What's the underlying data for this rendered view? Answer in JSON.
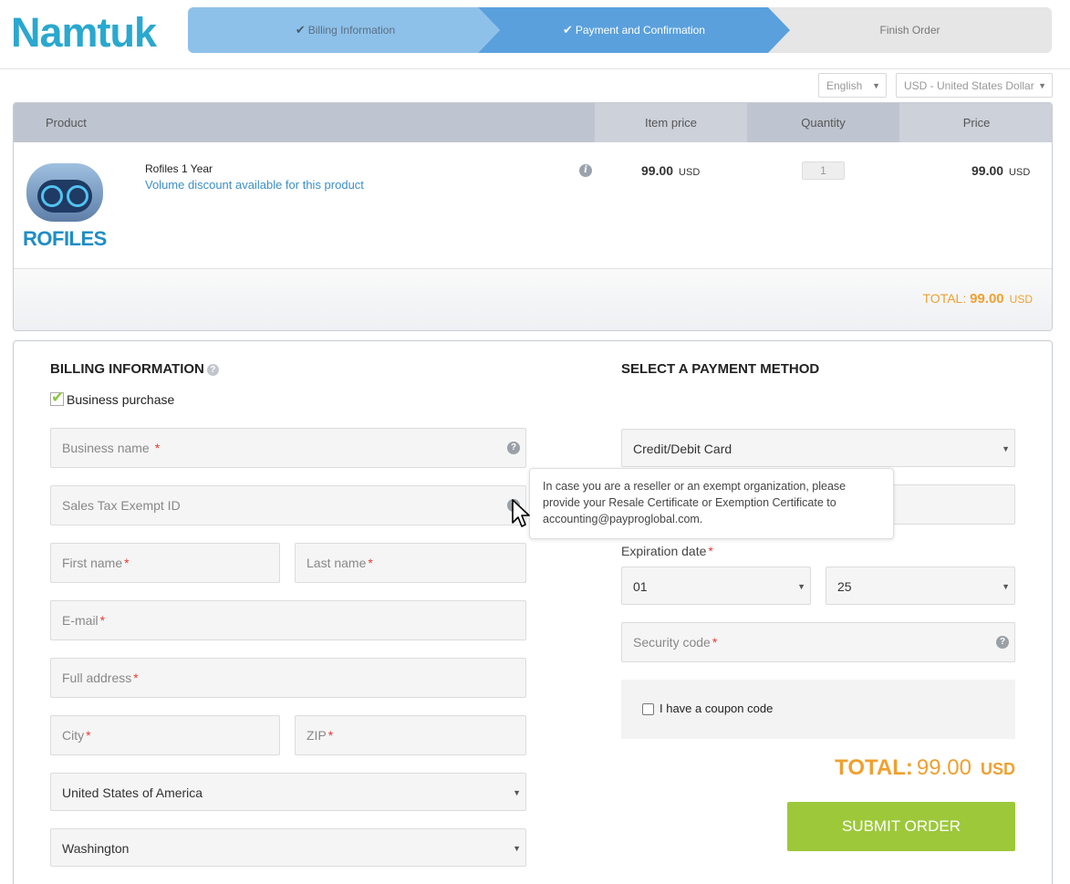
{
  "brand": {
    "logo": "Namtuk"
  },
  "steps": [
    {
      "label": "Billing Information",
      "check": "✔"
    },
    {
      "label": "Payment and Confirmation",
      "check": "✔"
    },
    {
      "label": "Finish Order"
    }
  ],
  "selectors": {
    "language": "English",
    "currency": "USD - United States Dollar",
    "caret": "▼"
  },
  "cart": {
    "headers": {
      "product": "Product",
      "item_price": "Item price",
      "quantity": "Quantity",
      "price": "Price"
    },
    "item": {
      "logo_text": "ROFILES",
      "name": "Rofiles 1 Year",
      "discount": "Volume discount available for this product",
      "info": "i",
      "item_price": "99.00",
      "item_currency": "USD",
      "quantity": "1",
      "price": "99.00",
      "price_currency": "USD"
    },
    "total_label": "TOTAL:",
    "total_value": "99.00",
    "total_currency": "USD"
  },
  "billing": {
    "title": "BILLING INFORMATION",
    "help": "?",
    "business_purchase": "Business purchase",
    "business_name": "Business name",
    "tax_id": "Sales Tax Exempt ID",
    "first_name": "First name",
    "last_name": "Last name",
    "email": "E-mail",
    "address": "Full address",
    "city": "City",
    "zip": "ZIP",
    "country": "United States of America",
    "state": "Washington",
    "required": "*"
  },
  "payment": {
    "title": "SELECT A PAYMENT METHOD",
    "method": "Credit/Debit Card",
    "expiration_label": "Expiration date",
    "exp_month": "01",
    "exp_year": "25",
    "security_code": "Security code",
    "coupon_label": "I have a coupon code",
    "total_label": "TOTAL:",
    "total_value": "99.00",
    "total_currency": "USD",
    "submit": "SUBMIT ORDER"
  },
  "tooltip": {
    "text": "In case you are a reseller or an exempt organization, please provide your Resale Certificate or Exemption Certificate to accounting@payproglobal.com."
  },
  "colors": {
    "accent": "#2aa8cf",
    "orange": "#f0a030",
    "green": "#9cc83a",
    "required": "#e53935"
  }
}
